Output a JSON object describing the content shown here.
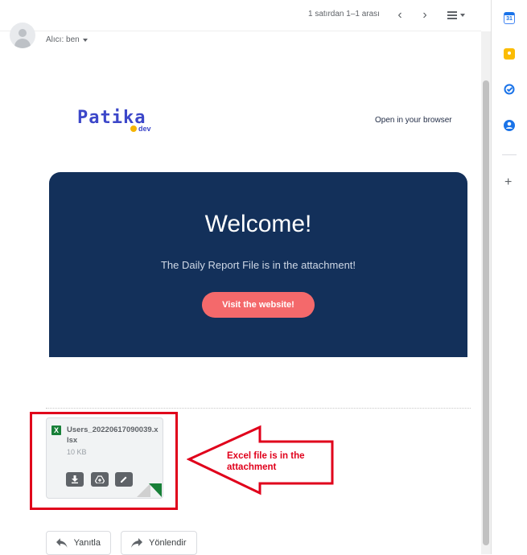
{
  "toolbar": {
    "pager_text": "1 satırdan 1–1 arası",
    "prev_icon": "chevron-left-icon",
    "next_icon": "chevron-right-icon",
    "menu_icon": "menu-lines-icon"
  },
  "message": {
    "to_label": "Alıcı: ben"
  },
  "email": {
    "logo_text": "Patika",
    "logo_sub": "dev",
    "browser_link": "Open in your browser",
    "heading": "Welcome!",
    "subtitle": "The Daily Report File is in the attachment!",
    "cta": "Visit the website!",
    "hero_color": "#13305a",
    "cta_color": "#f4696b"
  },
  "attachment": {
    "type_badge": "X",
    "file_name": "Users_20220617090039.xlsx",
    "size": "10 KB",
    "actions": [
      "download-icon",
      "save-to-drive-icon",
      "edit-icon"
    ]
  },
  "annotation": {
    "text": "Excel file is in the attachment",
    "color": "#e0001b"
  },
  "actions": {
    "reply": "Yanıtla",
    "forward": "Yönlendir"
  },
  "side_panel": {
    "icons": [
      "calendar-icon",
      "keep-icon",
      "tasks-icon",
      "contacts-icon",
      "add-icon"
    ],
    "calendar_day": "31"
  }
}
